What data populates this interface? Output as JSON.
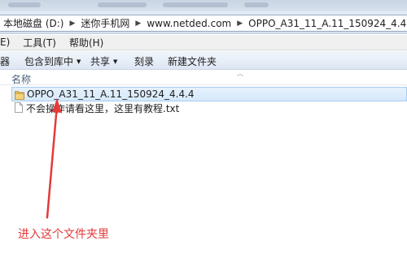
{
  "breadcrumb": {
    "items": [
      "本地磁盘 (D:)",
      "迷你手机网",
      "www.netded.com",
      "OPPO_A31_11_A.11_150924_4.4.4"
    ],
    "separator": "▶"
  },
  "menubar": {
    "items": [
      "E)",
      "工具(T)",
      "帮助(H)"
    ]
  },
  "toolbar": {
    "edge_label": "器",
    "include_library": "包含到库中",
    "share": "共享",
    "burn": "刻录",
    "new_folder": "新建文件夹",
    "dropdown_glyph": "▼"
  },
  "filelist": {
    "column_name": "名称",
    "sort_glyph": "︿",
    "rows": [
      {
        "name": "OPPO_A31_11_A.11_150924_4.4.4",
        "type": "folder",
        "selected": true
      },
      {
        "name": "不会操作请看这里，这里有教程.txt",
        "type": "text-file",
        "selected": false
      }
    ]
  },
  "annotation": {
    "text": "进入这个文件夹里",
    "color": "#e5393a"
  },
  "icons": {
    "folder": "folder-icon",
    "text_file": "text-file-icon"
  }
}
